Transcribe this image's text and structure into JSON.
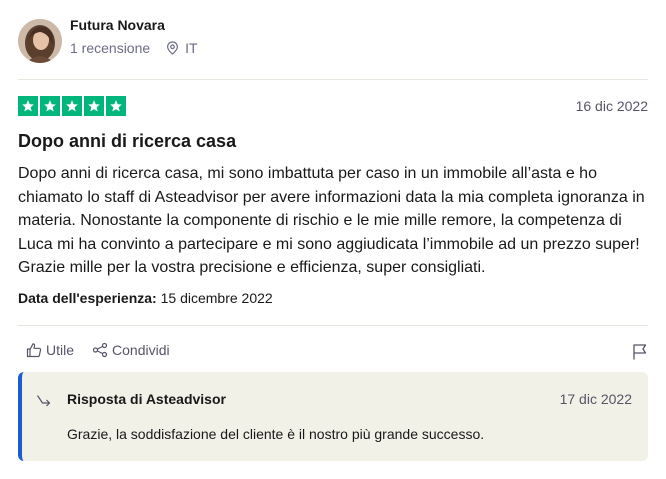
{
  "user": {
    "name": "Futura Novara",
    "reviews_count": "1 recensione",
    "country": "IT"
  },
  "review": {
    "rating": 5,
    "rating_color": "#00b67a",
    "date": "16 dic 2022",
    "title": "Dopo anni di ricerca casa",
    "text": "Dopo anni di ricerca casa, mi sono imbattuta per caso in un immobile all’asta e ho chiamato lo staff di Asteadvisor per avere informazioni data la mia completa ignoranza in materia. Nonostante la componente di rischio e le mie mille remore, la competenza di Luca mi ha convinto a partecipare e mi sono aggiudicata l’immobile ad un prezzo super! Grazie mille per la vostra precisione e efficienza, super consigliati.",
    "experience_label": "Data dell'esperienza:",
    "experience_date": "15 dicembre 2022"
  },
  "actions": {
    "useful_label": "Utile",
    "share_label": "Condividi",
    "icons": [
      "thumbs-up-icon",
      "share-icon",
      "flag-icon"
    ]
  },
  "reply": {
    "title": "Risposta di Asteadvisor",
    "date": "17 dic 2022",
    "text": "Grazie, la soddisfazione del cliente è il nostro più grande successo.",
    "accent_color": "#1c5ccf"
  }
}
